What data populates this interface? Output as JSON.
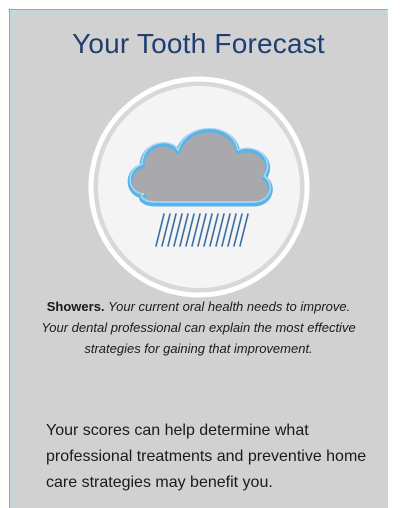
{
  "forecast": {
    "title": "Your Tooth Forecast",
    "icon": "rain-cloud-icon",
    "condition_label": "Showers.",
    "condition_text": "Your current oral health needs to improve. Your dental professional can explain the most effective strategies for gaining that improvement.",
    "summary": "Your scores can help determine what professional treatments and preventive home care strategies may benefit you."
  },
  "colors": {
    "panel_background": "#d1d1d1",
    "panel_border": "#66b6e6",
    "title": "#1e3f73",
    "cloud_outline": "#5db3e6",
    "cloud_fill": "#a9a9ab"
  }
}
